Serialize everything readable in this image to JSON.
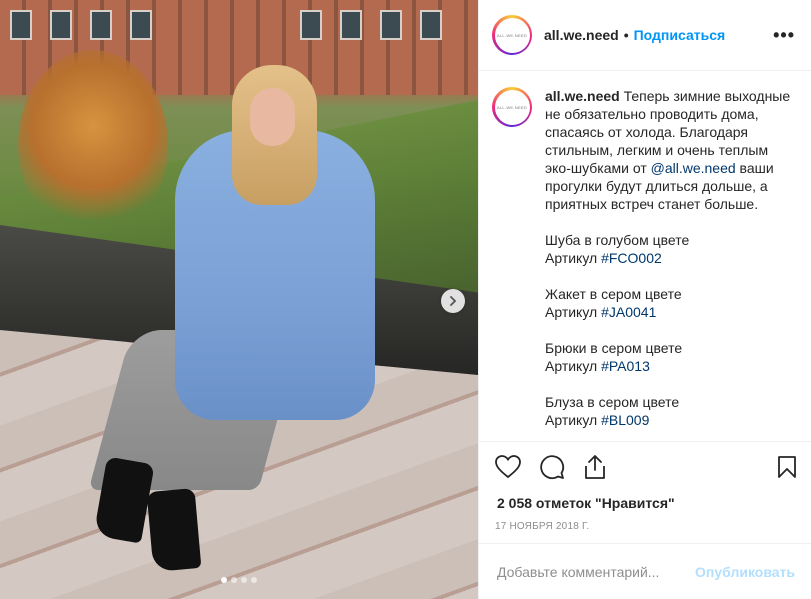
{
  "header": {
    "username": "all.we.need",
    "separator": "•",
    "follow_label": "Подписаться",
    "more_label": "•••",
    "avatar_text": "ALL.WE.NEED"
  },
  "caption": {
    "username": "all.we.need",
    "intro_1": "Теперь зимние выходные не обязательно проводить дома, спасаясь от холода. Благодаря стильным, легким и очень теплым эко-шубками от ",
    "mention": "@all.we.need",
    "intro_2": " ваши прогулки будут длиться дольше, а приятных встреч станет больше.",
    "items": [
      {
        "name": "Шуба в голубом цвете",
        "article_label": "Артикул",
        "tag": "#FCO002"
      },
      {
        "name": "Жакет в сером цвете",
        "article_label": "Артикул",
        "tag": "#JA0041"
      },
      {
        "name": "Брюки в сером цвете",
        "article_label": "Артикул",
        "tag": "#PA013"
      },
      {
        "name": "Блуза в сером цвете",
        "article_label": "Артикул",
        "tag": "#BL009"
      }
    ]
  },
  "likes_text": "2 058 отметок \"Нравится\"",
  "date_text": "17 ноября 2018 г.",
  "comment": {
    "placeholder": "Добавьте комментарий...",
    "publish_label": "Опубликовать"
  },
  "carousel": {
    "slide_count": 4,
    "active_index": 0
  },
  "icons": {
    "like": "heart-icon",
    "comment": "comment-icon",
    "share": "share-icon",
    "save": "bookmark-icon",
    "next": "chevron-right-icon"
  },
  "colors": {
    "link": "#0095f6",
    "mention": "#00376b",
    "muted": "#8e8e8e",
    "publish_disabled": "#b2dffc"
  }
}
